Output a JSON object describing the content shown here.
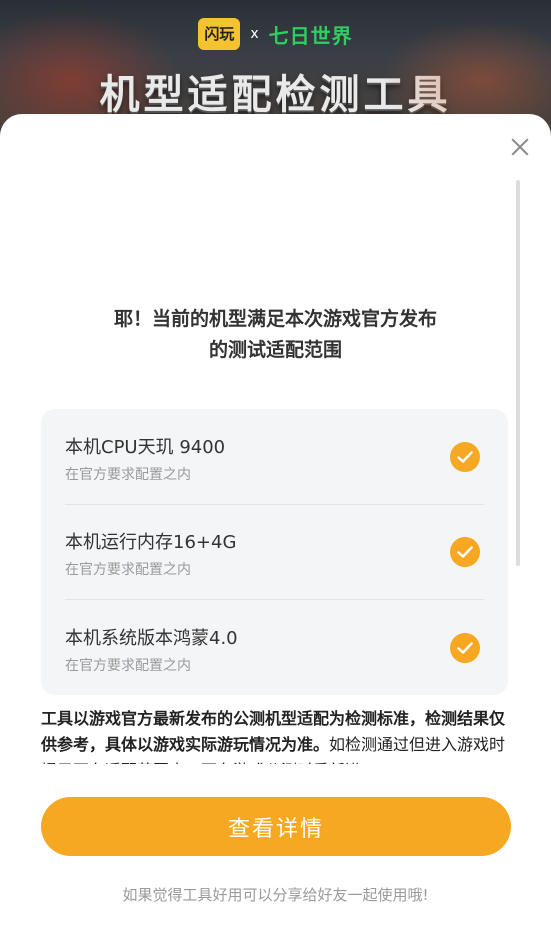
{
  "banner": {
    "logo_left": "闪玩",
    "logo_sep": "x",
    "logo_right": "七日世界",
    "title": "机型适配检测工具"
  },
  "dialog": {
    "headline_line1": "耶！当前的机型满足本次游戏官方发布",
    "headline_line2": "的测试适配范围",
    "checks": [
      {
        "title": "本机CPU天玑 9400",
        "subtitle": "在官方要求配置之内"
      },
      {
        "title": "本机运行内存16+4G",
        "subtitle": "在官方要求配置之内"
      },
      {
        "title": "本机系统版本鸿蒙4.0",
        "subtitle": "在官方要求配置之内"
      }
    ],
    "note_bold": "工具以游戏官方最新发布的公测机型适配为检测标准，检测结果仅供参考，具体以游戏实际游玩情况为准。",
    "note_rest": "如检测通过但进入游戏时提示不在适配范围内，可在游戏公测时重新进",
    "details_button": "查看详情",
    "share_tip": "如果觉得工具好用可以分享给好友一起使用哦!"
  },
  "colors": {
    "accent": "#f7a823",
    "check_icon": "check-icon"
  }
}
